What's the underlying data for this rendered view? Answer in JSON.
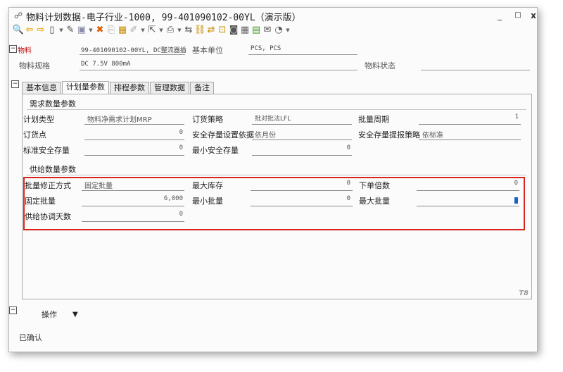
{
  "window": {
    "title": "物料计划数据-电子行业-1000, 99-401090102-00YL（演示版）",
    "title_icon": "material-plan-icon",
    "min_glyph": "_",
    "max_glyph": "□",
    "close_glyph": "x"
  },
  "toolbar": {
    "icons": [
      "search-icon",
      "back-arrow-icon",
      "forward-arrow-icon",
      "new-document-icon",
      "edit-icon",
      "save-icon",
      "delete-icon",
      "copy-icon",
      "paste-icon",
      "attach-icon",
      "export-icon",
      "print-icon",
      "route-icon",
      "link-icon",
      "exchange-icon",
      "lock-icon",
      "camera-icon",
      "calculator-icon",
      "database-icon",
      "mail-icon",
      "chat-icon"
    ],
    "glyphs": {
      "search-icon": "🔍",
      "back-arrow-icon": "⇦",
      "forward-arrow-icon": "⇨",
      "new-document-icon": "🗋",
      "edit-icon": "✎",
      "save-icon": "🖫",
      "delete-icon": "✖",
      "copy-icon": "⎘",
      "paste-icon": "📋",
      "attach-icon": "🔗",
      "export-icon": "⇱",
      "print-icon": "⎙",
      "route-icon": "⇆",
      "link-icon": "⛓",
      "exchange-icon": "⇄",
      "lock-icon": "🔒",
      "camera-icon": "◙",
      "calculator-icon": "▦",
      "database-icon": "▤",
      "mail-icon": "✉",
      "chat-icon": "💬"
    }
  },
  "header": {
    "material_label": "物料",
    "material_value": "99-401090102-00YL, DC整流器插",
    "base_unit_label": "基本单位",
    "base_unit_value": "PCS, PCS",
    "spec_label": "物料规格",
    "spec_value": "DC 7.5V 800mA",
    "status_label": "物料状态",
    "status_value": ""
  },
  "tabs": [
    {
      "label": "基本信息",
      "active": false
    },
    {
      "label": "计划量参数",
      "active": true
    },
    {
      "label": "排程参数",
      "active": false
    },
    {
      "label": "管理数据",
      "active": false
    },
    {
      "label": "备注",
      "active": false
    }
  ],
  "demand": {
    "title": "需求数量参数",
    "plan_type_label": "计划类型",
    "plan_type_value": "物料净需求计划MRP",
    "order_strategy_label": "订货策略",
    "order_strategy_value": "批对批法LFL",
    "batch_period_label": "批量周期",
    "batch_period_value": "1",
    "reorder_point_label": "订货点",
    "reorder_point_value": "0",
    "safety_basis_label": "安全存量设置依据",
    "safety_basis_value": "依月份",
    "safety_alert_label": "安全存量提报策略",
    "safety_alert_value": "依标准",
    "std_safety_label": "标准安全存量",
    "std_safety_value": "0",
    "min_safety_label": "最小安全存量",
    "min_safety_value": "0"
  },
  "supply": {
    "title": "供给数量参数",
    "batch_correction_label": "批量修正方式",
    "batch_correction_value": "固定批量",
    "max_stock_label": "最大库存",
    "max_stock_value": "0",
    "order_multiple_label": "下单倍数",
    "order_multiple_value": "0",
    "fixed_batch_label": "固定批量",
    "fixed_batch_value": "6,000",
    "min_batch_label": "最小批量",
    "min_batch_value": "0",
    "max_batch_label": "最大批量",
    "max_batch_value": "",
    "lead_days_label": "供给协调天数",
    "lead_days_value": "0"
  },
  "watermark": "T8",
  "footer": {
    "operate_label": "操作",
    "operate_arrow": "▼",
    "status_text": "已确认"
  },
  "colors": {
    "highlight": "#d9231f",
    "required_label": "#c00000"
  }
}
